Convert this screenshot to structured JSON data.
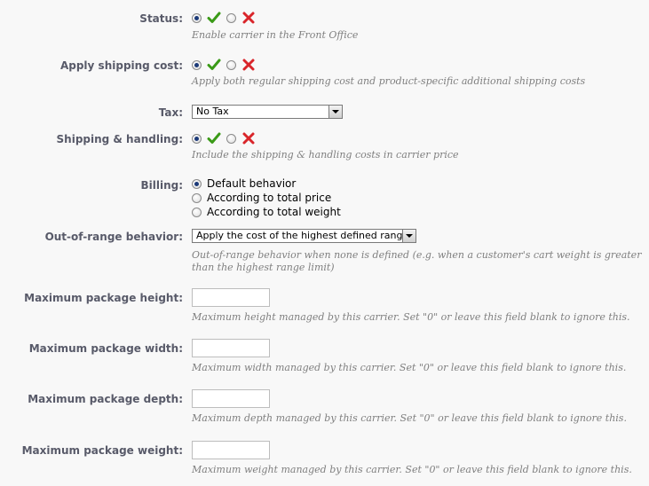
{
  "status": {
    "label": "Status:",
    "value": "yes",
    "hint": "Enable carrier in the Front Office"
  },
  "apply_shipping_cost": {
    "label": "Apply shipping cost:",
    "value": "yes",
    "hint": "Apply both regular shipping cost and product-specific additional shipping costs"
  },
  "tax": {
    "label": "Tax:",
    "selected": "No Tax"
  },
  "shipping_handling": {
    "label": "Shipping & handling:",
    "value": "yes",
    "hint": "Include the shipping & handling costs in carrier price"
  },
  "billing": {
    "label": "Billing:",
    "options": [
      {
        "label": "Default behavior",
        "checked": true
      },
      {
        "label": "According to total price",
        "checked": false
      },
      {
        "label": "According to total weight",
        "checked": false
      }
    ]
  },
  "out_of_range": {
    "label": "Out-of-range behavior:",
    "selected": "Apply the cost of the highest defined range",
    "hint_line1": "Out-of-range behavior when none is defined (e.g. when a customer's cart weight is greater",
    "hint_line2": "than the highest range limit)"
  },
  "max_height": {
    "label": "Maximum package height:",
    "value": "",
    "hint": "Maximum height managed by this carrier. Set \"0\" or leave this field blank to ignore this."
  },
  "max_width": {
    "label": "Maximum package width:",
    "value": "",
    "hint": "Maximum width managed by this carrier. Set \"0\" or leave this field blank to ignore this."
  },
  "max_depth": {
    "label": "Maximum package depth:",
    "value": "",
    "hint": "Maximum depth managed by this carrier. Set \"0\" or leave this field blank to ignore this."
  },
  "max_weight": {
    "label": "Maximum package weight:",
    "value": "",
    "hint": "Maximum weight managed by this carrier. Set \"0\" or leave this field blank to ignore this."
  },
  "icons": {
    "yes": "green-check-icon",
    "no": "red-cross-icon"
  },
  "colors": {
    "label": "#585a69",
    "hint": "#7f7f7f",
    "yes": "#3a9a17",
    "no": "#d9252a"
  }
}
